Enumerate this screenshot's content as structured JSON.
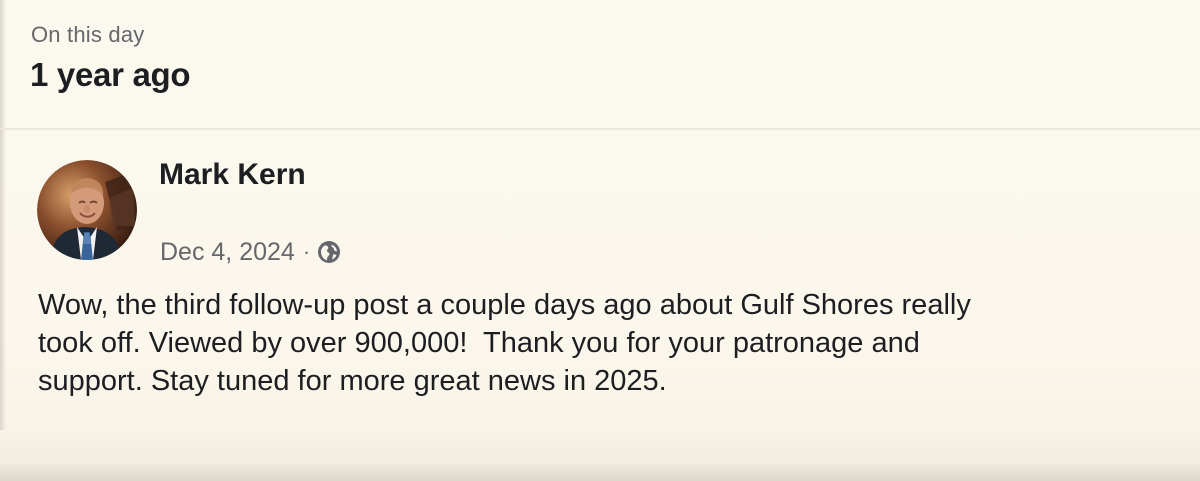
{
  "memory": {
    "label": "On this day",
    "title": "1 year ago"
  },
  "post": {
    "author": "Mark Kern",
    "date": "Dec 4, 2024",
    "separator": "·",
    "audience_icon": "globe-icon",
    "avatar_icon": "profile-photo",
    "text": "Wow, the third follow-up post a couple days ago about Gulf Shores really\ntook off. Viewed by over 900,000!  Thank you for your patronage and\nsupport. Stay tuned for more great news in 2025."
  },
  "colors": {
    "background": "#fbf7ec",
    "primary_text": "#1c1e21",
    "secondary_text": "#65676b",
    "divider": "#ebe7dd"
  }
}
